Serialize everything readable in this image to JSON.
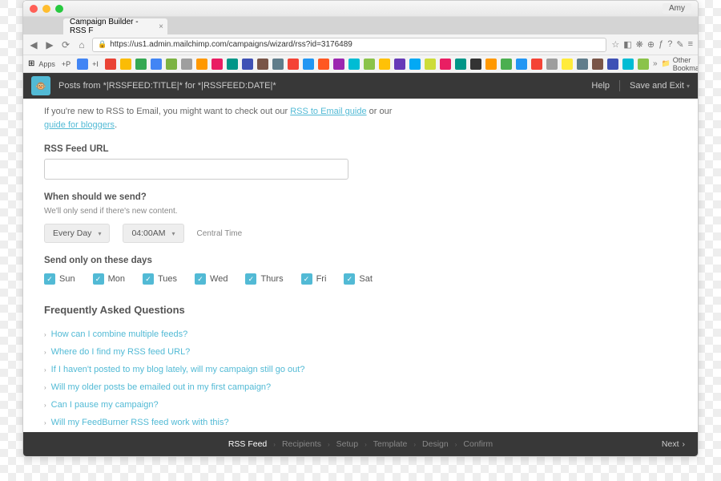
{
  "browser": {
    "user": "Amy",
    "tab_title": "Campaign Builder - RSS F",
    "url": "https://us1.admin.mailchimp.com/campaigns/wizard/rss?id=3176489",
    "apps_label": "Apps",
    "other_bookmarks": "Other Bookmarks"
  },
  "appbar": {
    "title": "Posts from *|RSSFEED:TITLE|* for *|RSSFEED:DATE|*",
    "help": "Help",
    "save": "Save and Exit"
  },
  "content": {
    "intro_prefix": "If you're new to RSS to Email, you might want to check out our ",
    "intro_link1": "RSS to Email guide",
    "intro_mid": " or our ",
    "intro_link2": "guide for bloggers",
    "rss_label": "RSS Feed URL",
    "rss_value": "",
    "when_label": "When should we send?",
    "when_sub": "We'll only send if there's new content.",
    "frequency": "Every Day",
    "time": "04:00AM",
    "timezone": "Central Time",
    "days_label": "Send only on these days",
    "days": [
      "Sun",
      "Mon",
      "Tues",
      "Wed",
      "Thurs",
      "Fri",
      "Sat"
    ],
    "faq_title": "Frequently Asked Questions",
    "faqs": [
      "How can I combine multiple feeds?",
      "Where do I find my RSS feed URL?",
      "If I haven't posted to my blog lately, will my campaign still go out?",
      "Will my older posts be emailed out in my first campaign?",
      "Can I pause my campaign?",
      "Will my FeedBurner RSS feed work with this?"
    ]
  },
  "footer": {
    "steps": [
      "RSS Feed",
      "Recipients",
      "Setup",
      "Template",
      "Design",
      "Confirm"
    ],
    "next": "Next"
  }
}
